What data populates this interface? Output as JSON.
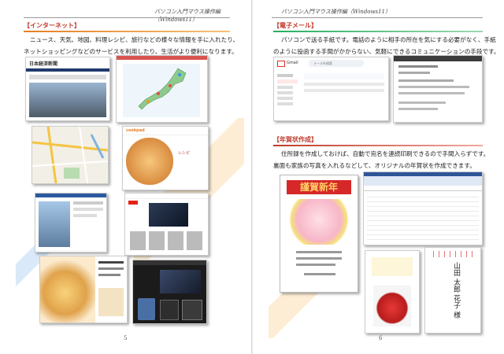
{
  "header": {
    "left_title": "パソコン入門マウス操作編（Windows11）",
    "right_title": "パソコン入門マウス操作編（Windows11）"
  },
  "left_page": {
    "section_title": "【インターネット】",
    "body_line1": "ニュース、天気、地図、料理レシピ、旅行などの様々な情報を手に入れたり、",
    "body_line2": "ネットショッピングなどのサービスを利用したり、生活がより便利になります。",
    "page_number": "5",
    "thumb_news_logo": "日本経済新聞",
    "thumb_recipe_title": "レシピ"
  },
  "right_page": {
    "mail_section_title": "【電子メール】",
    "mail_body_line1": "パソコンで送る手紙です。電話のように相手の所在を気にする必要がなく、手紙",
    "mail_body_line2": "のように投函する手間がかからない、気軽にできるコミュニケーションの手段です。",
    "nenga_section_title": "【年賀状作成】",
    "nenga_body_line1": "住所録を作成しておけば、自動で宛名を連続印刷できるので手間入らずです。",
    "nenga_body_line2": "裏面も家族の写真を入れるなどして、オリジナルの年賀状を作成できます。",
    "page_number": "6",
    "gmail_label": "Gmail",
    "gmail_search_placeholder": "メールを検索",
    "nenga_card_text": "謹賀新年",
    "address_name": "山田 太郎 花子 様"
  },
  "colors": {
    "section_red": "#c0392b",
    "rule_orange": "#e67e22",
    "rule_green": "#27ae60",
    "deco_blue": "#6fa8dc"
  }
}
